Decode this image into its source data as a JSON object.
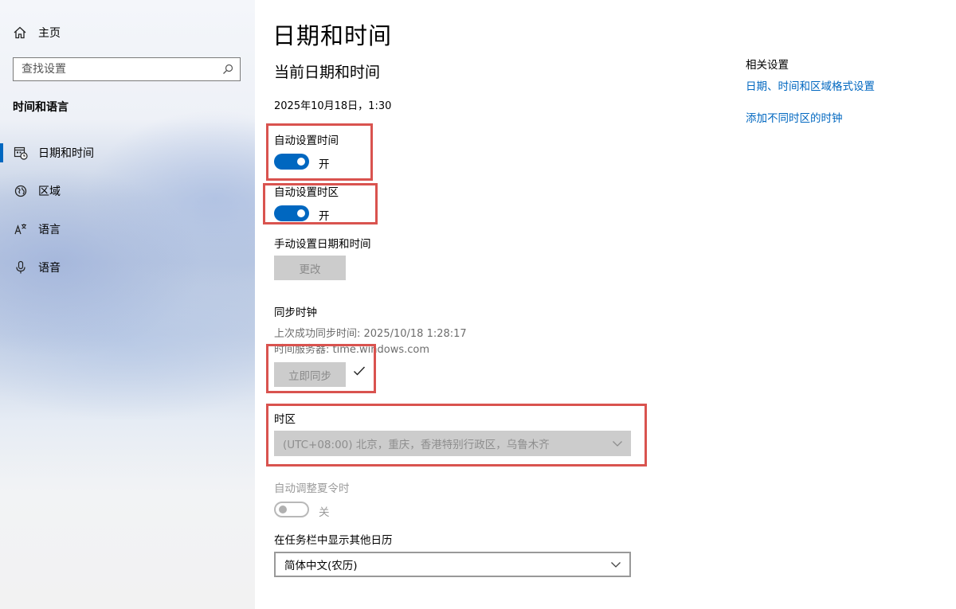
{
  "sidebar": {
    "home_label": "主页",
    "search_placeholder": "查找设置",
    "section_title": "时间和语言",
    "items": [
      {
        "label": "日期和时间",
        "icon": "calendar-clock-icon",
        "active": true
      },
      {
        "label": "区域",
        "icon": "globe-icon",
        "active": false
      },
      {
        "label": "语言",
        "icon": "language-icon",
        "active": false
      },
      {
        "label": "语音",
        "icon": "microphone-icon",
        "active": false
      }
    ]
  },
  "main": {
    "title": "日期和时间",
    "subtitle": "当前日期和时间",
    "current_datetime": "2025年10月18日，1:30",
    "auto_time": {
      "label": "自动设置时间",
      "state": "开",
      "on": true
    },
    "auto_timezone": {
      "label": "自动设置时区",
      "state": "开",
      "on": true
    },
    "manual": {
      "label": "手动设置日期和时间",
      "button": "更改"
    },
    "sync": {
      "label": "同步时钟",
      "last_sync": "上次成功同步时间: 2025/10/18 1:28:17",
      "server": "时间服务器: time.windows.com",
      "button": "立即同步"
    },
    "timezone": {
      "label": "时区",
      "value": "(UTC+08:00) 北京，重庆，香港特别行政区，乌鲁木齐"
    },
    "dst": {
      "label": "自动调整夏令时",
      "state": "关",
      "on": false
    },
    "calendar": {
      "label": "在任务栏中显示其他日历",
      "value": "简体中文(农历)"
    }
  },
  "related": {
    "title": "相关设置",
    "links": [
      "日期、时间和区域格式设置",
      "添加不同时区的时钟"
    ]
  },
  "colors": {
    "accent": "#0067c0",
    "annotation": "#d9534f"
  }
}
